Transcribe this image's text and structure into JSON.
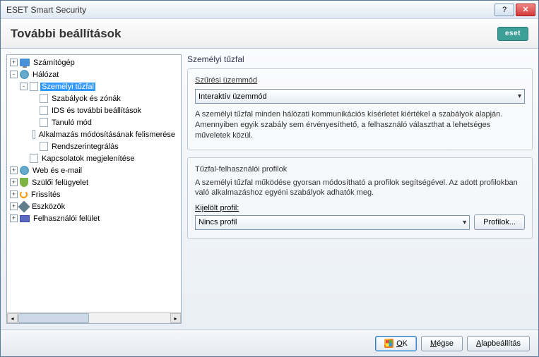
{
  "window": {
    "title": "ESET Smart Security"
  },
  "header": {
    "title": "További beállítások",
    "logo": "eset"
  },
  "tree": {
    "items": [
      {
        "label": "Számítógép",
        "icon": "monitor",
        "expand": "+",
        "indent": 0
      },
      {
        "label": "Hálózat",
        "icon": "globe",
        "expand": "-",
        "indent": 0
      },
      {
        "label": "Személyi tűzfal",
        "icon": "page",
        "expand": "-",
        "indent": 1,
        "selected": true
      },
      {
        "label": "Szabályok és zónák",
        "icon": "page",
        "expand": "",
        "indent": 2
      },
      {
        "label": "IDS és további beállítások",
        "icon": "page",
        "expand": "",
        "indent": 2
      },
      {
        "label": "Tanuló mód",
        "icon": "page",
        "expand": "",
        "indent": 2
      },
      {
        "label": "Alkalmazás módosításának felismerése",
        "icon": "page",
        "expand": "",
        "indent": 2
      },
      {
        "label": "Rendszerintegrálás",
        "icon": "page",
        "expand": "",
        "indent": 2
      },
      {
        "label": "Kapcsolatok megjelenítése",
        "icon": "page",
        "expand": "",
        "indent": 1
      },
      {
        "label": "Web és e-mail",
        "icon": "globe",
        "expand": "+",
        "indent": 0
      },
      {
        "label": "Szülői felügyelet",
        "icon": "shield",
        "expand": "+",
        "indent": 0
      },
      {
        "label": "Frissítés",
        "icon": "refresh",
        "expand": "+",
        "indent": 0
      },
      {
        "label": "Eszközök",
        "icon": "tools",
        "expand": "+",
        "indent": 0
      },
      {
        "label": "Felhasználói felület",
        "icon": "ui",
        "expand": "+",
        "indent": 0
      }
    ]
  },
  "main": {
    "title": "Személyi tűzfal",
    "filter": {
      "legend": "Szűrési üzemmód",
      "value": "Interaktív üzemmód",
      "desc": "A személyi tűzfal minden hálózati kommunikációs kísérletet kiértékel a szabályok alapján. Amennyiben egyik szabály sem érvényesíthető, a felhasználó választhat a lehetséges műveletek közül."
    },
    "profiles": {
      "legend": "Tűzfal-felhasználói profilok",
      "desc": "A személyi tűzfal működése gyorsan módosítható a profilok segítségével. Az adott profilokban való alkalmazáshoz egyéni szabályok adhatók meg.",
      "label": "Kijelölt profil:",
      "value": "Nincs profil",
      "button": "Profilok..."
    }
  },
  "footer": {
    "ok": "OK",
    "cancel": "Mégse",
    "default": "Alapbeállítás"
  }
}
